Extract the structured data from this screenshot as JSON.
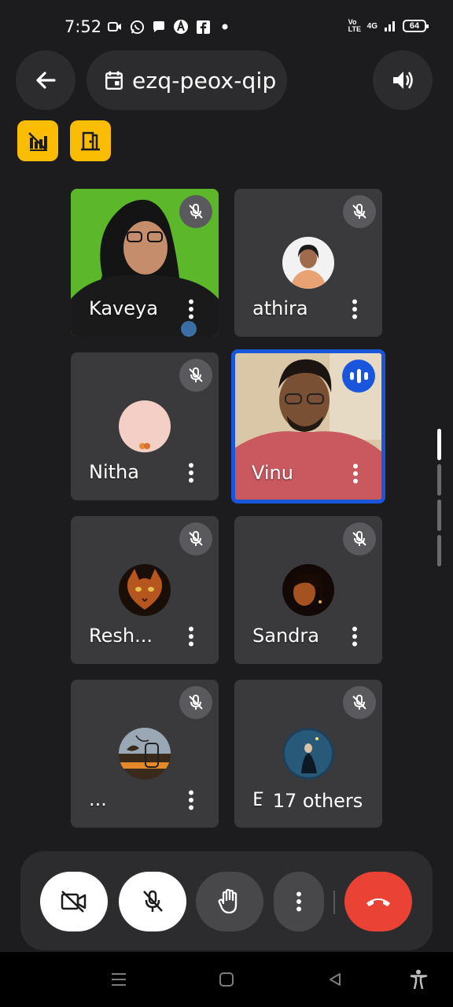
{
  "status_bar": {
    "time": "7:52",
    "icons": [
      "video-notification-icon",
      "whatsapp-icon",
      "chat-icon",
      "app-a-icon",
      "facebook-icon",
      "dot-icon"
    ],
    "network": "4G",
    "volte": "Vo LTE",
    "battery": "64"
  },
  "header": {
    "meeting_code": "ezq-peox-qip"
  },
  "participants": [
    {
      "name": "Kaveya",
      "muted": true,
      "video": true
    },
    {
      "name": "athira",
      "muted": true,
      "video": false
    },
    {
      "name": "Nitha",
      "muted": true,
      "video": false
    },
    {
      "name": "Vinu",
      "muted": false,
      "video": true,
      "speaking": true
    },
    {
      "name": "Resh...",
      "muted": true,
      "video": false
    },
    {
      "name": "Sandra",
      "muted": true,
      "video": false
    },
    {
      "name": "...",
      "muted": true,
      "video": false
    },
    {
      "name": "Eri...",
      "muted": true,
      "video": false
    }
  ],
  "others_label": "17 others",
  "colors": {
    "background": "#1c1c1e",
    "tile": "#3a3a3c",
    "accent": "#1a56db",
    "end_call": "#ea4335",
    "highlight": "#fbbc04"
  }
}
